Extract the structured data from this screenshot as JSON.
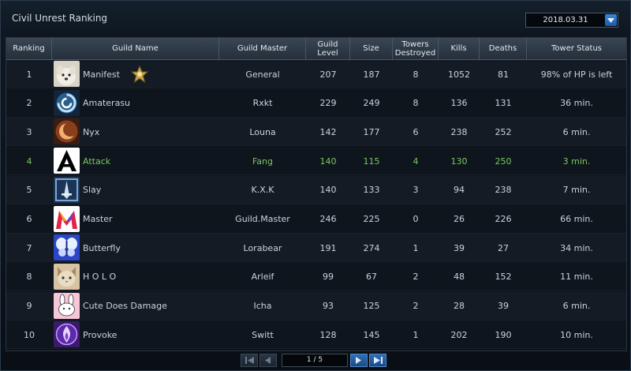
{
  "window": {
    "title": "Civil Unrest Ranking",
    "date_select": "2018.03.31"
  },
  "columns": {
    "ranking": "Ranking",
    "guild_name": "Guild Name",
    "guild_master": "Guild Master",
    "guild_level": "Guild Level",
    "size": "Size",
    "towers_destroyed_1": "Towers",
    "towers_destroyed_2": "Destroyed",
    "kills": "Kills",
    "deaths": "Deaths",
    "tower_status": "Tower Status"
  },
  "rows": [
    {
      "rank": "1",
      "name": "Manifest",
      "master": "General",
      "level": "207",
      "size": "187",
      "towers": "8",
      "kills": "1052",
      "deaths": "81",
      "status": "98% of HP is left",
      "emblem": "dog-icon",
      "highlight": false
    },
    {
      "rank": "2",
      "name": "Amaterasu",
      "master": "Rxkt",
      "level": "229",
      "size": "249",
      "towers": "8",
      "kills": "136",
      "deaths": "131",
      "status": "36 min.",
      "emblem": "swirl-icon",
      "highlight": false
    },
    {
      "rank": "3",
      "name": "Nyx",
      "master": "Louna",
      "level": "142",
      "size": "177",
      "towers": "6",
      "kills": "238",
      "deaths": "252",
      "status": "6 min.",
      "emblem": "crescent-moon-icon",
      "highlight": false
    },
    {
      "rank": "4",
      "name": "Attack",
      "master": "Fang",
      "level": "140",
      "size": "115",
      "towers": "4",
      "kills": "130",
      "deaths": "250",
      "status": "3 min.",
      "emblem": "letter-a-icon",
      "highlight": true
    },
    {
      "rank": "5",
      "name": "Slay",
      "master": "K.X.K",
      "level": "140",
      "size": "133",
      "towers": "3",
      "kills": "94",
      "deaths": "238",
      "status": "7 min.",
      "emblem": "sword-crest-icon",
      "highlight": false
    },
    {
      "rank": "6",
      "name": "Master",
      "master": "Guild.Master",
      "level": "246",
      "size": "225",
      "towers": "0",
      "kills": "26",
      "deaths": "226",
      "status": "66 min.",
      "emblem": "letter-m-icon",
      "highlight": false
    },
    {
      "rank": "7",
      "name": "Butterfly",
      "master": "Lorabear",
      "level": "191",
      "size": "274",
      "towers": "1",
      "kills": "39",
      "deaths": "27",
      "status": "34 min.",
      "emblem": "butterfly-icon",
      "highlight": false
    },
    {
      "rank": "8",
      "name": "H O L O",
      "master": "Arleif",
      "level": "99",
      "size": "67",
      "towers": "2",
      "kills": "48",
      "deaths": "152",
      "status": "11 min.",
      "emblem": "cat-icon",
      "highlight": false
    },
    {
      "rank": "9",
      "name": "Cute Does Damage",
      "master": "Icha",
      "level": "93",
      "size": "125",
      "towers": "2",
      "kills": "28",
      "deaths": "39",
      "status": "6 min.",
      "emblem": "bunny-icon",
      "highlight": false
    },
    {
      "rank": "10",
      "name": "Provoke",
      "master": "Switt",
      "level": "128",
      "size": "145",
      "towers": "1",
      "kills": "202",
      "deaths": "190",
      "status": "10 min.",
      "emblem": "flame-icon",
      "highlight": false
    }
  ],
  "pager": {
    "page_info": "1 / 5"
  },
  "colors": {
    "highlight_row": "#79c861",
    "accent_blue": "#2e6fb8"
  }
}
